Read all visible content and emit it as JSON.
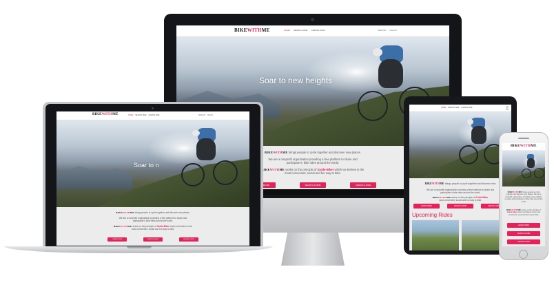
{
  "site": {
    "brand_main": "BIKE",
    "brand_with": "WITH",
    "brand_me": "ME",
    "nav": [
      "HOME",
      "SEARCH RIDE",
      "CREATE RIDE"
    ],
    "auth": [
      "SIGN UP",
      "LOG IN"
    ],
    "hero_title": "Soar to new heights",
    "hero_title_short": "Soar to n",
    "intro_line": "brings people to cycle together and discover new places.",
    "intro_line_tablet": "brings people to cycle together and discover new",
    "nonprofit_1": "We are a nonprofit organization providing a free platform to share and",
    "nonprofit_2": "participate in bike rides around the world.",
    "principle_pre": "works on the principle of",
    "principle_bold": "Guide-Biker",
    "principle_post": "which we believe is the",
    "principle_2": "most convenient, social and fun way to bike.",
    "buttons": [
      "LEARN MORE",
      "SEARCH A RIDE",
      "CREATE A RIDE"
    ],
    "upcoming_title": "Upcoming Rides"
  },
  "colors": {
    "accent": "#e5235a",
    "device_dark": "#1c1d20",
    "footer_bar": "#101010"
  }
}
